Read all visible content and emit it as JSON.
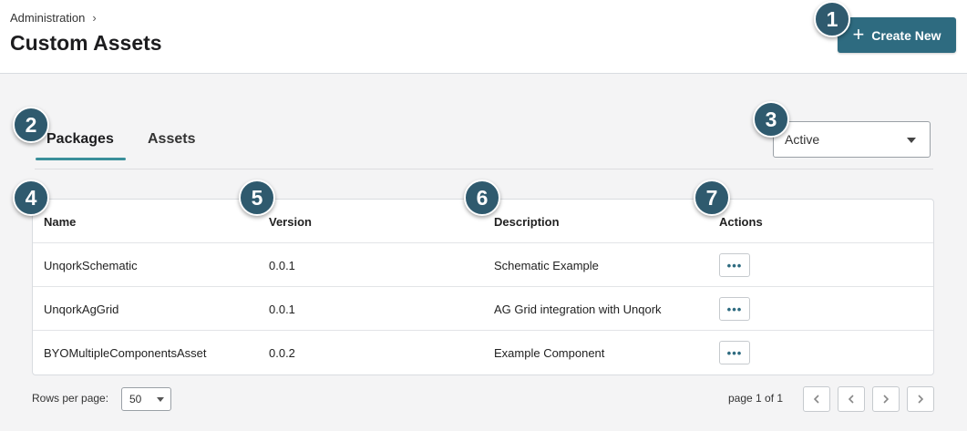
{
  "header": {
    "breadcrumb": "Administration",
    "breadcrumb_chevron": "›",
    "title": "Custom Assets",
    "create_button": "Create New",
    "create_icon": "+"
  },
  "tabs": [
    {
      "label": "Packages",
      "active": true
    },
    {
      "label": "Assets",
      "active": false
    }
  ],
  "status_filter": {
    "value": "Active"
  },
  "table": {
    "columns": [
      "Name",
      "Version",
      "Description",
      "Actions"
    ],
    "rows": [
      {
        "name": "UnqorkSchematic",
        "version": "0.0.1",
        "description": "Schematic Example",
        "action": "•••"
      },
      {
        "name": "UnqorkAgGrid",
        "version": "0.0.1",
        "description": "AG Grid integration with Unqork",
        "action": "•••"
      },
      {
        "name": "BYOMultipleComponentsAsset",
        "version": "0.0.2",
        "description": "Example Component",
        "action": "•••"
      }
    ]
  },
  "pagination": {
    "rows_per_page_label": "Rows per page:",
    "rows_per_page_value": "50",
    "page_info": "page 1 of 1",
    "buttons": [
      "first-page",
      "previous-page",
      "next-page",
      "last-page"
    ]
  },
  "callouts": [
    "1",
    "2",
    "3",
    "4",
    "5",
    "6",
    "7"
  ],
  "colors": {
    "primary": "#2e6b80",
    "tab_underline": "#3a8f9a",
    "callout_badge": "#2f5a6e",
    "page_background": "#f4f4f5"
  }
}
